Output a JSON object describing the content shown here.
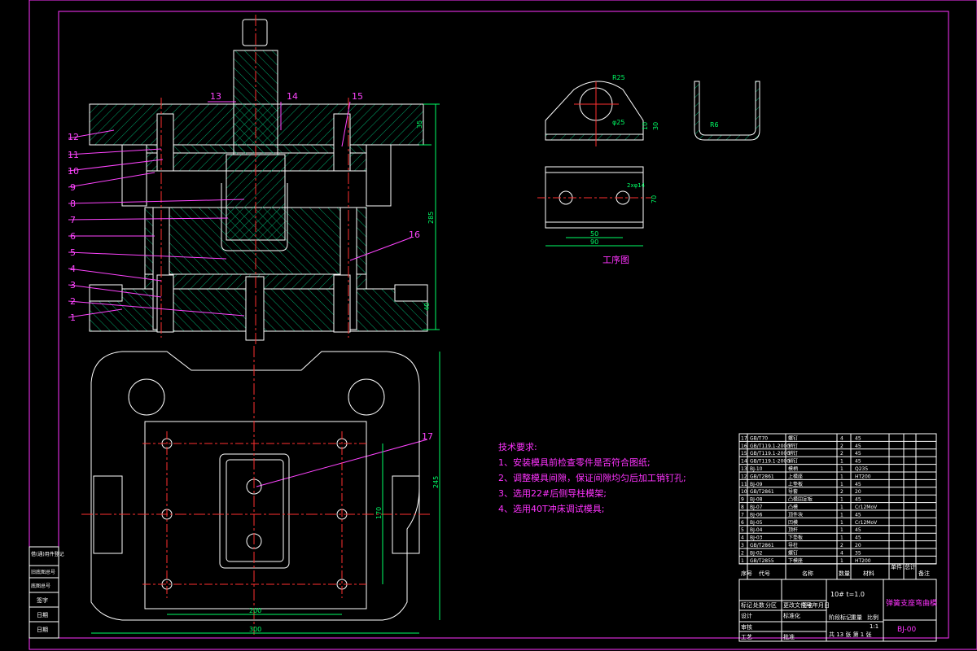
{
  "colors": {
    "background": "#000000",
    "outline": "#ffffff",
    "hatch": "#00a86b",
    "centerline": "#ff3030",
    "dimension": "#00ff66",
    "leader": "#ff44ff",
    "frame": "#ff33ff",
    "text_note": "#ff33ff",
    "table": "#ffffff"
  },
  "callouts": [
    "1",
    "2",
    "3",
    "4",
    "5",
    "6",
    "7",
    "8",
    "9",
    "10",
    "11",
    "12",
    "13",
    "14",
    "15",
    "16",
    "17"
  ],
  "dimensions": {
    "top_plate_thickness": "35",
    "total_height": "285",
    "base_height": "40",
    "plan_height": "245",
    "plan_inner_height": "170",
    "plan_width_inner": "200",
    "plan_width_outer": "300",
    "part_radius": "R25",
    "part_hole": "φ25",
    "part_thk": "10",
    "part_height": "30",
    "part_bend_radius": "R6",
    "holes": "2xφ14",
    "hole_spacing": "50",
    "part_width": "90",
    "part_depth": "70"
  },
  "process_drawing_label": "工序图",
  "notes": {
    "heading": "技术要求:",
    "items": [
      "1、安装模具前检查零件是否符合图纸;",
      "2、调整模具间隙，保证间隙均匀后加工销钉孔;",
      "3、选用22#后侧导柱模架;",
      "4、选用40T冲床调试模具;"
    ]
  },
  "title_block": {
    "material": "10#  t=1.0",
    "title": "弹簧支座弯曲模",
    "drawing_no": "BJ-00",
    "scale": "1:1",
    "sheet": "共 13 张  第 1 张",
    "header_labels": [
      "序号",
      "代号",
      "名称",
      "数量",
      "材料",
      "单件",
      "总计",
      "备注"
    ],
    "parts_rows": [
      [
        "17",
        "GB/T70",
        "螺钉",
        "4",
        "45"
      ],
      [
        "16",
        "GB/T119.1-2000",
        "销钉",
        "2",
        "45"
      ],
      [
        "15",
        "GB/T119.1-2000",
        "销钉",
        "2",
        "45"
      ],
      [
        "14",
        "GB/T119.1-2000",
        "销钉",
        "1",
        "45"
      ],
      [
        "13",
        "BJ-10",
        "模柄",
        "1",
        "Q235"
      ],
      [
        "12",
        "GB/T2861",
        "上模座",
        "1",
        "HT200"
      ],
      [
        "11",
        "BJ-09",
        "上垫板",
        "1",
        "45"
      ],
      [
        "10",
        "GB/T2861",
        "导套",
        "2",
        "20"
      ],
      [
        "9",
        "BJ-08",
        "凸模固定板",
        "1",
        "45"
      ],
      [
        "8",
        "BJ-07",
        "凸模",
        "1",
        "Cr12MoV"
      ],
      [
        "7",
        "BJ-06",
        "顶件块",
        "1",
        "45"
      ],
      [
        "6",
        "BJ-05",
        "凹模",
        "1",
        "Cr12MoV"
      ],
      [
        "5",
        "BJ-04",
        "顶杆",
        "1",
        "45"
      ],
      [
        "4",
        "BJ-03",
        "下垫板",
        "1",
        "45"
      ],
      [
        "3",
        "GB/T2861",
        "导柱",
        "2",
        "20"
      ],
      [
        "2",
        "BJ-02",
        "螺钉",
        "4",
        "35"
      ],
      [
        "1",
        "GB/T2855",
        "下模座",
        "1",
        "HT200"
      ]
    ],
    "sign_labels": [
      "标记",
      "处数",
      "分区",
      "更改文件号",
      "签名",
      "年月日",
      "设计",
      "审核",
      "工艺",
      "标准化",
      "批准",
      "阶段标记",
      "重量",
      "比例"
    ]
  },
  "revision_block": [
    "借(通)用件登记",
    "旧底图总号",
    "底图总号",
    "签字",
    "日期",
    "日期"
  ]
}
